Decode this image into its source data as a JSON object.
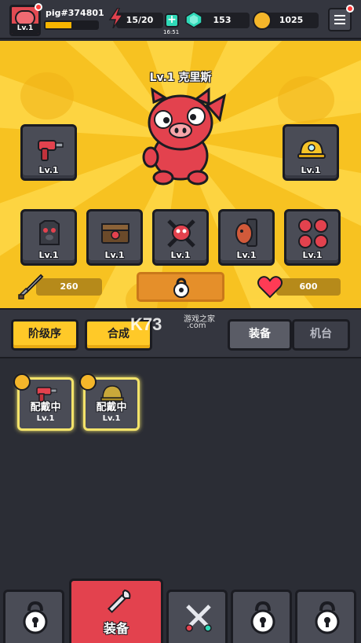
{
  "colors": {
    "hero_bg": "#f7c221",
    "panel_dark": "#2b2d35",
    "accent_yellow": "#ffc928",
    "accent_red": "#e3424e",
    "equipped_glow": "#f3e36a"
  },
  "top_bar": {
    "player_name": "pig#374801",
    "player_level": "Lv.1",
    "xp_fraction": 0.5,
    "energy": "15/20",
    "energy_timer": "16:51",
    "gems": "153",
    "coins": "1025",
    "icons": [
      "energy-bolt-icon",
      "plus-icon",
      "gem-icon",
      "coin-icon",
      "menu-icon"
    ]
  },
  "hero": {
    "character_name": "Lv.1 克里斯",
    "left_slot_level": "Lv.1",
    "right_slot_level": "Lv.1",
    "row_slots": [
      {
        "icon": "dark-pig-mask-icon",
        "level": "Lv.1"
      },
      {
        "icon": "chest-icon",
        "level": "Lv.1"
      },
      {
        "icon": "crossed-skull-icon",
        "level": "Lv.1"
      },
      {
        "icon": "pig-shield-icon",
        "level": "Lv.1"
      },
      {
        "icon": "pig-squad-icon",
        "level": "Lv.1"
      }
    ],
    "attack": "260",
    "health": "600"
  },
  "tabs": {
    "sort_label": "阶级序",
    "merge_label": "合成",
    "equipment_label": "装备",
    "platform_label": "机台",
    "watermark_brand": "K73",
    "watermark_sub": "游戏之家",
    "watermark_domain": ".com"
  },
  "inventory": [
    {
      "status": "配戴中",
      "level": "Lv.1",
      "badge": "sword-badge-icon"
    },
    {
      "status": "配戴中",
      "level": "Lv.1",
      "badge": "helmet-badge-icon"
    }
  ],
  "bottom_nav": {
    "active_label": "装备"
  }
}
